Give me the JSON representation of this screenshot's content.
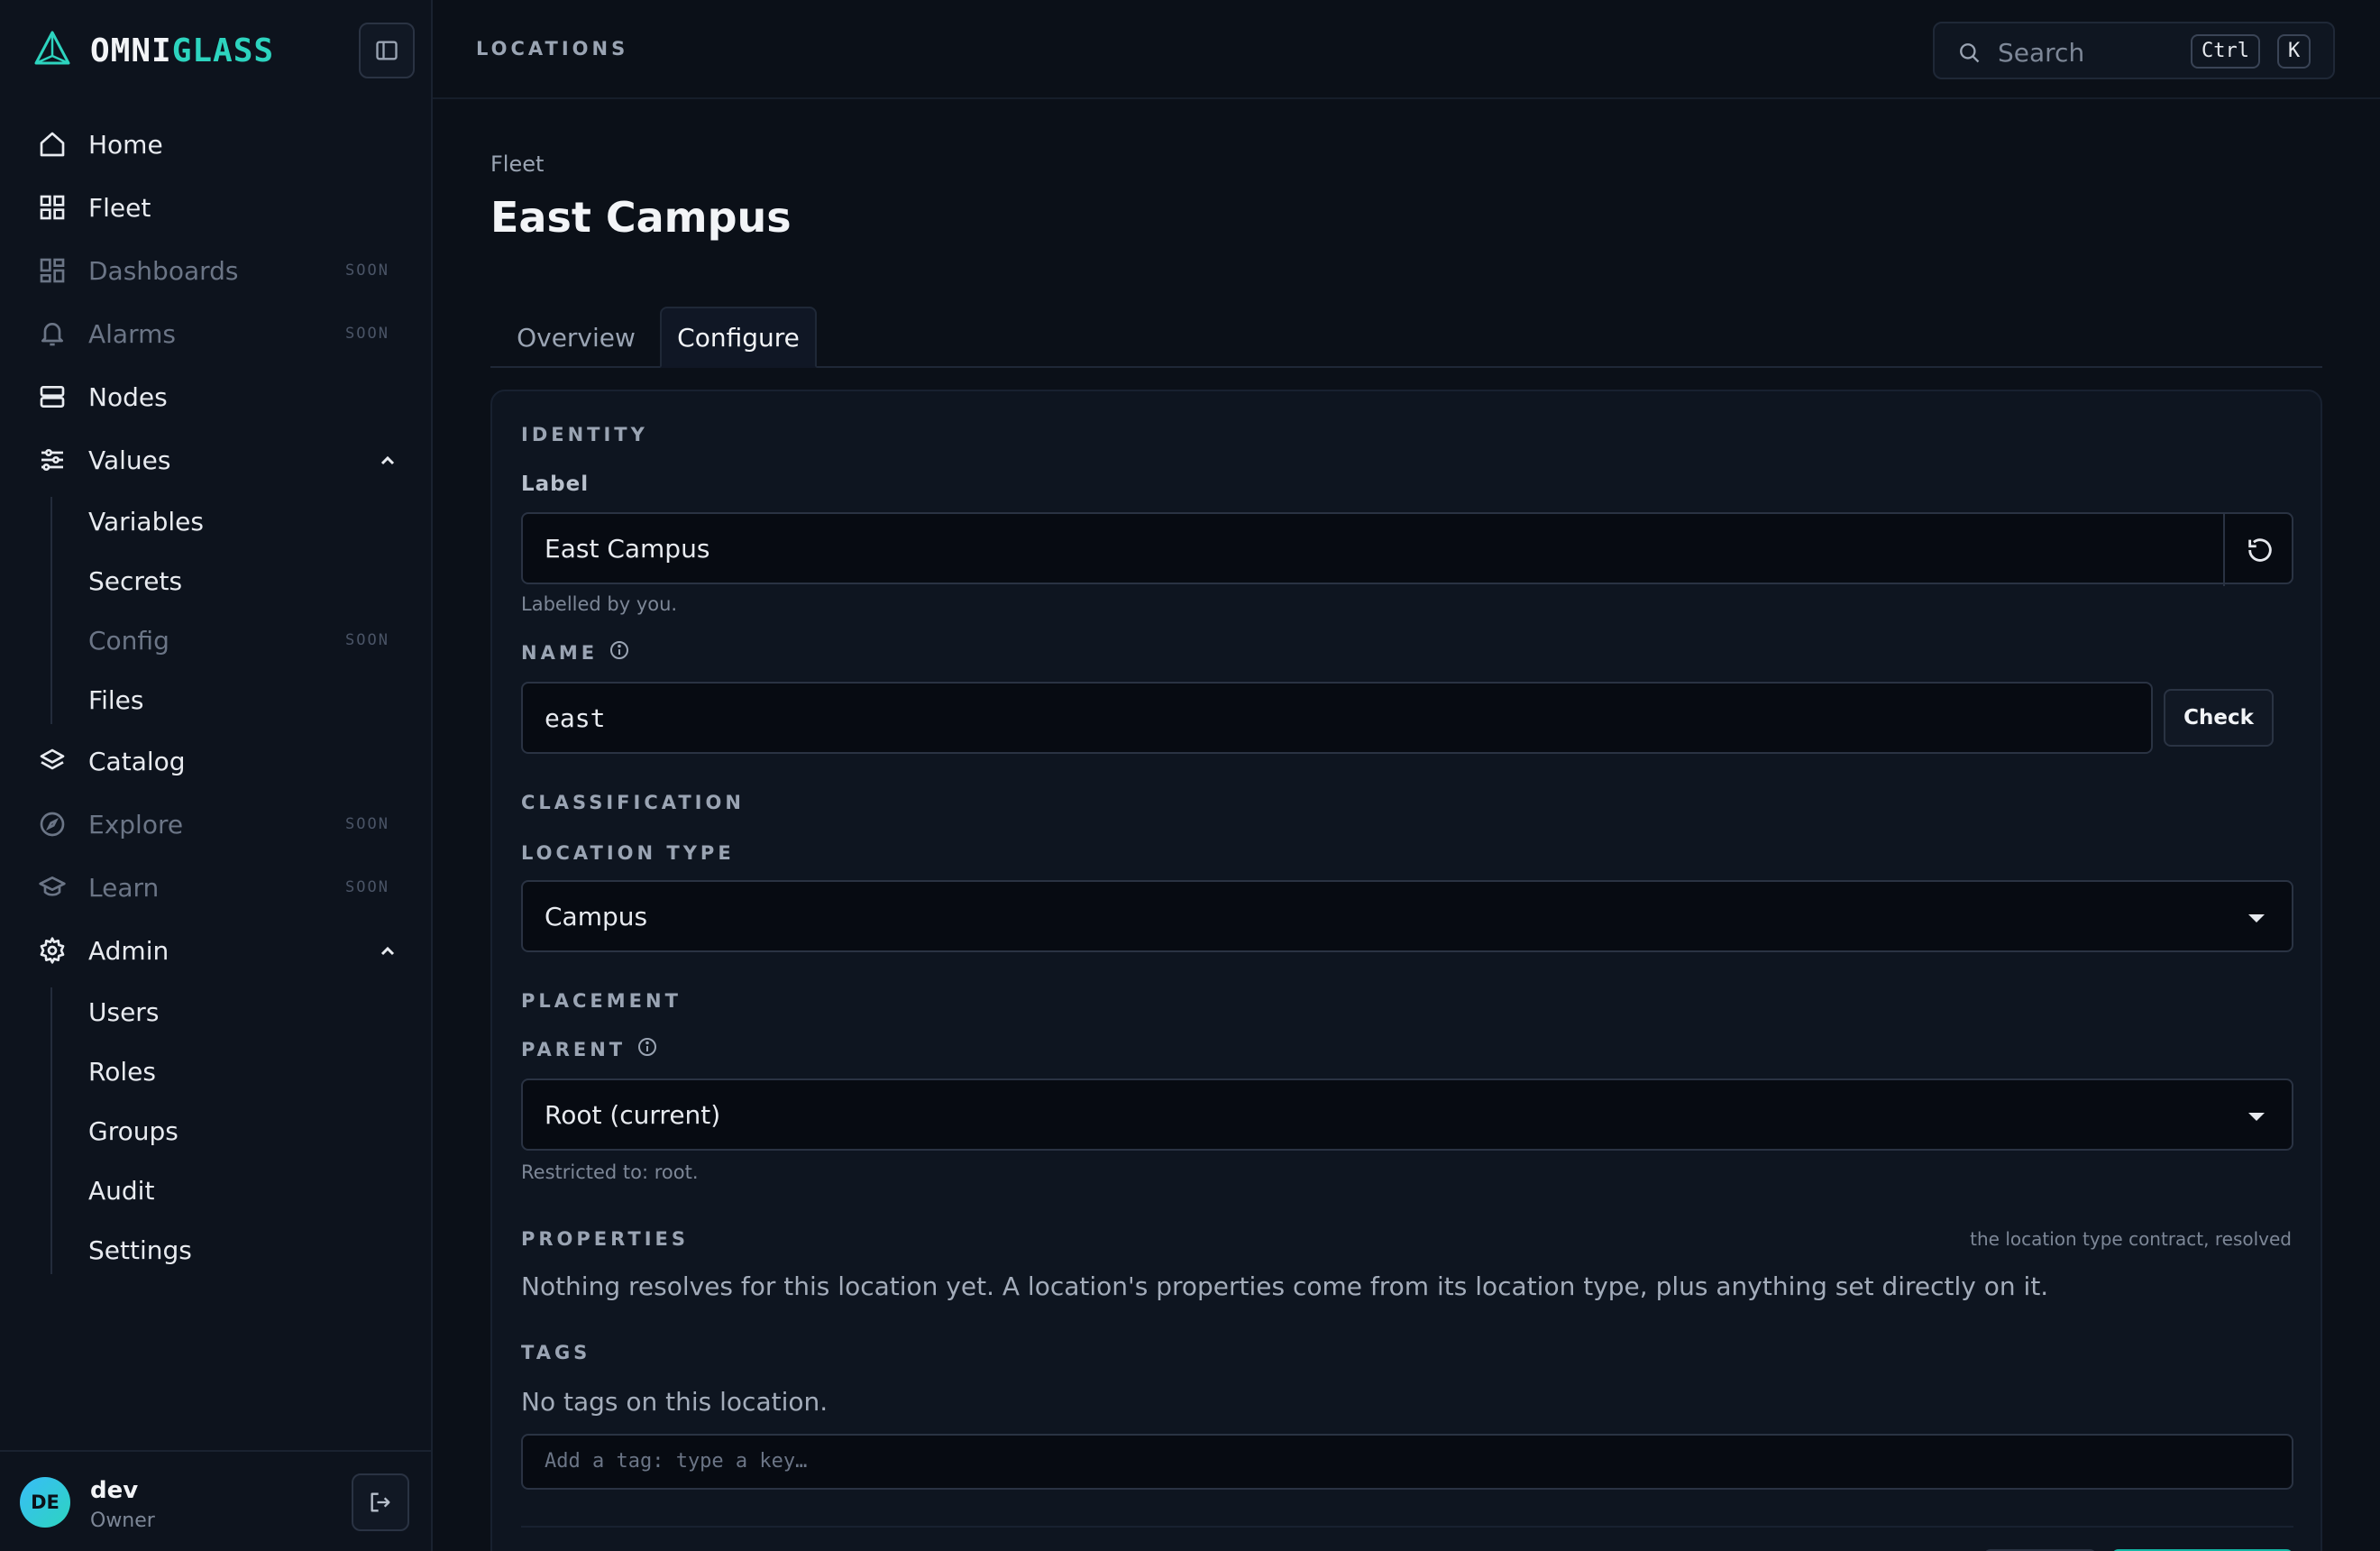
{
  "brand": {
    "name_part1": "OMNI",
    "name_part2": "GLASS",
    "accent_color": "#2dd4bf"
  },
  "sidebar": {
    "items": [
      {
        "label": "Home",
        "icon": "home-icon"
      },
      {
        "label": "Fleet",
        "icon": "grid-icon"
      },
      {
        "label": "Dashboards",
        "icon": "dashboard-icon",
        "badge": "SOON"
      },
      {
        "label": "Alarms",
        "icon": "bell-icon",
        "badge": "SOON"
      },
      {
        "label": "Nodes",
        "icon": "server-icon"
      },
      {
        "label": "Values",
        "icon": "sliders-icon",
        "expanded": true,
        "children": [
          {
            "label": "Variables"
          },
          {
            "label": "Secrets"
          },
          {
            "label": "Config",
            "badge": "SOON"
          },
          {
            "label": "Files"
          }
        ]
      },
      {
        "label": "Catalog",
        "icon": "layers-icon"
      },
      {
        "label": "Explore",
        "icon": "compass-icon",
        "badge": "SOON"
      },
      {
        "label": "Learn",
        "icon": "graduation-cap-icon",
        "badge": "SOON"
      },
      {
        "label": "Admin",
        "icon": "gear-icon",
        "expanded": true,
        "children": [
          {
            "label": "Users"
          },
          {
            "label": "Roles"
          },
          {
            "label": "Groups"
          },
          {
            "label": "Audit"
          },
          {
            "label": "Settings"
          }
        ]
      }
    ],
    "user": {
      "initials": "DE",
      "name": "dev",
      "role": "Owner"
    }
  },
  "topbar": {
    "title": "LOCATIONS",
    "search_placeholder": "Search",
    "shortcut_keys": [
      "Ctrl",
      "K"
    ]
  },
  "page": {
    "breadcrumb": "Fleet",
    "title": "East Campus",
    "tabs": [
      {
        "label": "Overview"
      },
      {
        "label": "Configure",
        "active": true
      }
    ]
  },
  "form": {
    "identity": {
      "section": "IDENTITY",
      "label_label": "Label",
      "label_value": "East Campus",
      "label_help": "Labelled by you.",
      "name_label": "NAME",
      "name_value": "east",
      "check_label": "Check"
    },
    "classification": {
      "section": "CLASSIFICATION",
      "type_label": "LOCATION TYPE",
      "type_value": "Campus"
    },
    "placement": {
      "section": "PLACEMENT",
      "parent_label": "PARENT",
      "parent_value": "Root (current)",
      "parent_help": "Restricted to: root."
    },
    "properties": {
      "section": "PROPERTIES",
      "hint": "the location type contract, resolved",
      "empty_text": "Nothing resolves for this location yet. A location's properties come from its location type, plus anything set directly on it."
    },
    "tags": {
      "section": "TAGS",
      "empty_text": "No tags on this location.",
      "input_placeholder": "Add a tag: type a key…"
    }
  }
}
